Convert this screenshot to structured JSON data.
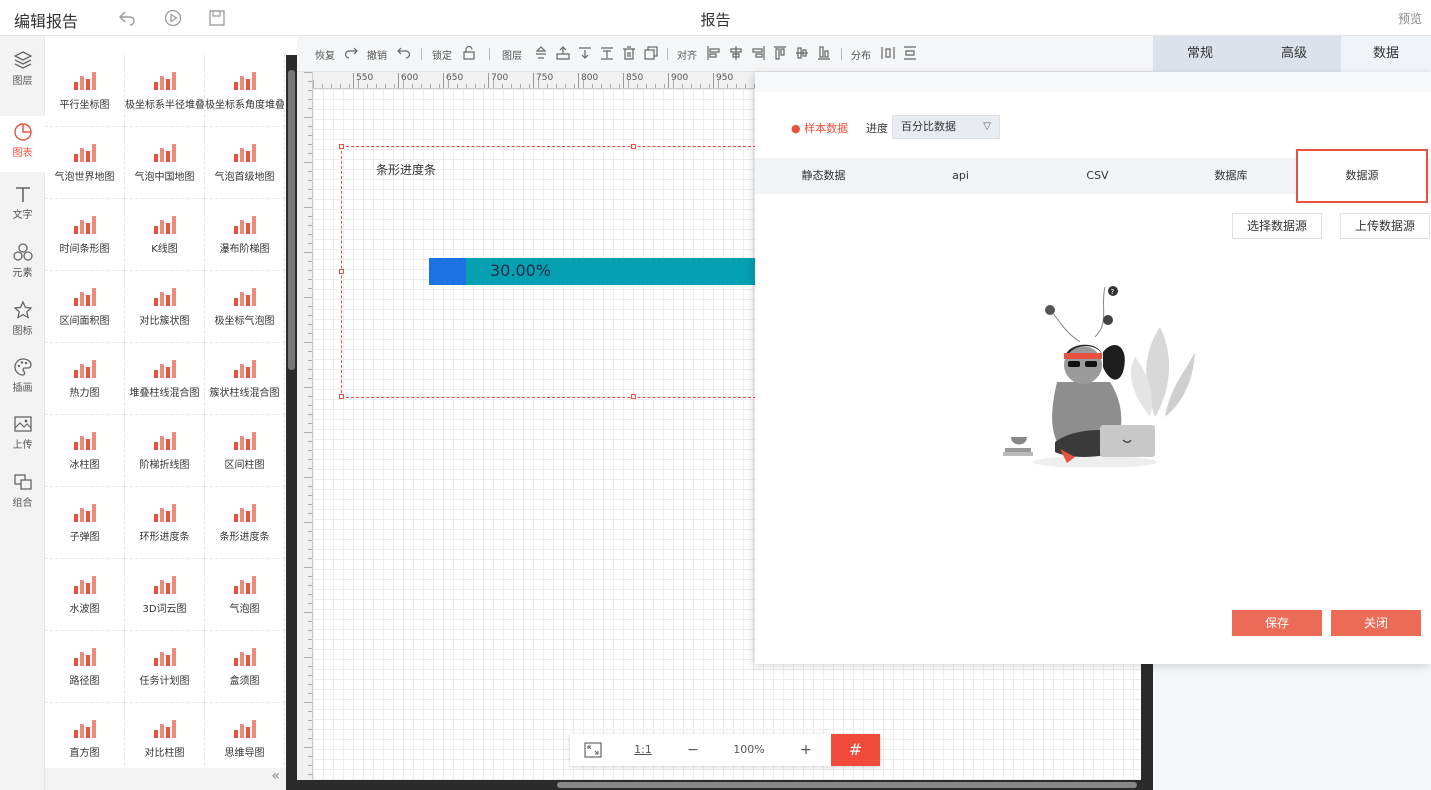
{
  "header": {
    "app_title": "编辑报告",
    "page_title": "报告",
    "preview": "预览"
  },
  "leftnav": [
    {
      "label": "图层",
      "icon": "layers-icon",
      "active": false
    },
    {
      "label": "图表",
      "icon": "chart-icon",
      "active": true
    },
    {
      "label": "文字",
      "icon": "text-icon",
      "active": false
    },
    {
      "label": "元素",
      "icon": "elements-icon",
      "active": false
    },
    {
      "label": "图标",
      "icon": "star-icon",
      "active": false
    },
    {
      "label": "插画",
      "icon": "palette-icon",
      "active": false
    },
    {
      "label": "上传",
      "icon": "upload-image-icon",
      "active": false
    },
    {
      "label": "组合",
      "icon": "group-icon",
      "active": false
    }
  ],
  "palette": [
    "平行坐标图",
    "极坐标系半径堆叠",
    "极坐标系角度堆叠",
    "气泡世界地图",
    "气泡中国地图",
    "气泡首级地图",
    "时间条形图",
    "K线图",
    "瀑布阶梯图",
    "区间面积图",
    "对比簇状图",
    "极坐标气泡图",
    "热力图",
    "堆叠柱线混合图",
    "簇状柱线混合图",
    "冰柱图",
    "阶梯折线图",
    "区间柱图",
    "子弹图",
    "环形进度条",
    "条形进度条",
    "水波图",
    "3D词云图",
    "气泡图",
    "路径图",
    "任务计划图",
    "盒须图",
    "直方图",
    "对比柱图",
    "思维导图"
  ],
  "toolbar": {
    "redo": "恢复",
    "undo": "撤销",
    "lock": "锁定",
    "layer": "图层",
    "align": "对齐",
    "distribute": "分布"
  },
  "ruler": {
    "ticks": [
      "550",
      "600",
      "650",
      "700",
      "750",
      "800",
      "850",
      "900",
      "950"
    ]
  },
  "widget": {
    "title": "条形进度条",
    "progress": 0.3,
    "progress_label": "30.00%"
  },
  "zoombar": {
    "ratio": "1:1",
    "minus": "−",
    "zoom": "100%",
    "plus": "+"
  },
  "right_tabs": [
    "常规",
    "高级",
    "数据"
  ],
  "data_dialog": {
    "sample_data": "样本数据",
    "progress_label": "进度",
    "progress_select": "百分比数据",
    "source_tabs": [
      "静态数据",
      "api",
      "CSV",
      "数据库",
      "数据源"
    ],
    "choose_source": "选择数据源",
    "upload_source": "上传数据源",
    "save": "保存",
    "close": "关闭"
  },
  "colors": {
    "accent": "#e8523f",
    "progress_fill": "#1a73e0",
    "progress_track": "#05a1b2",
    "button_red": "#ec6b57"
  }
}
